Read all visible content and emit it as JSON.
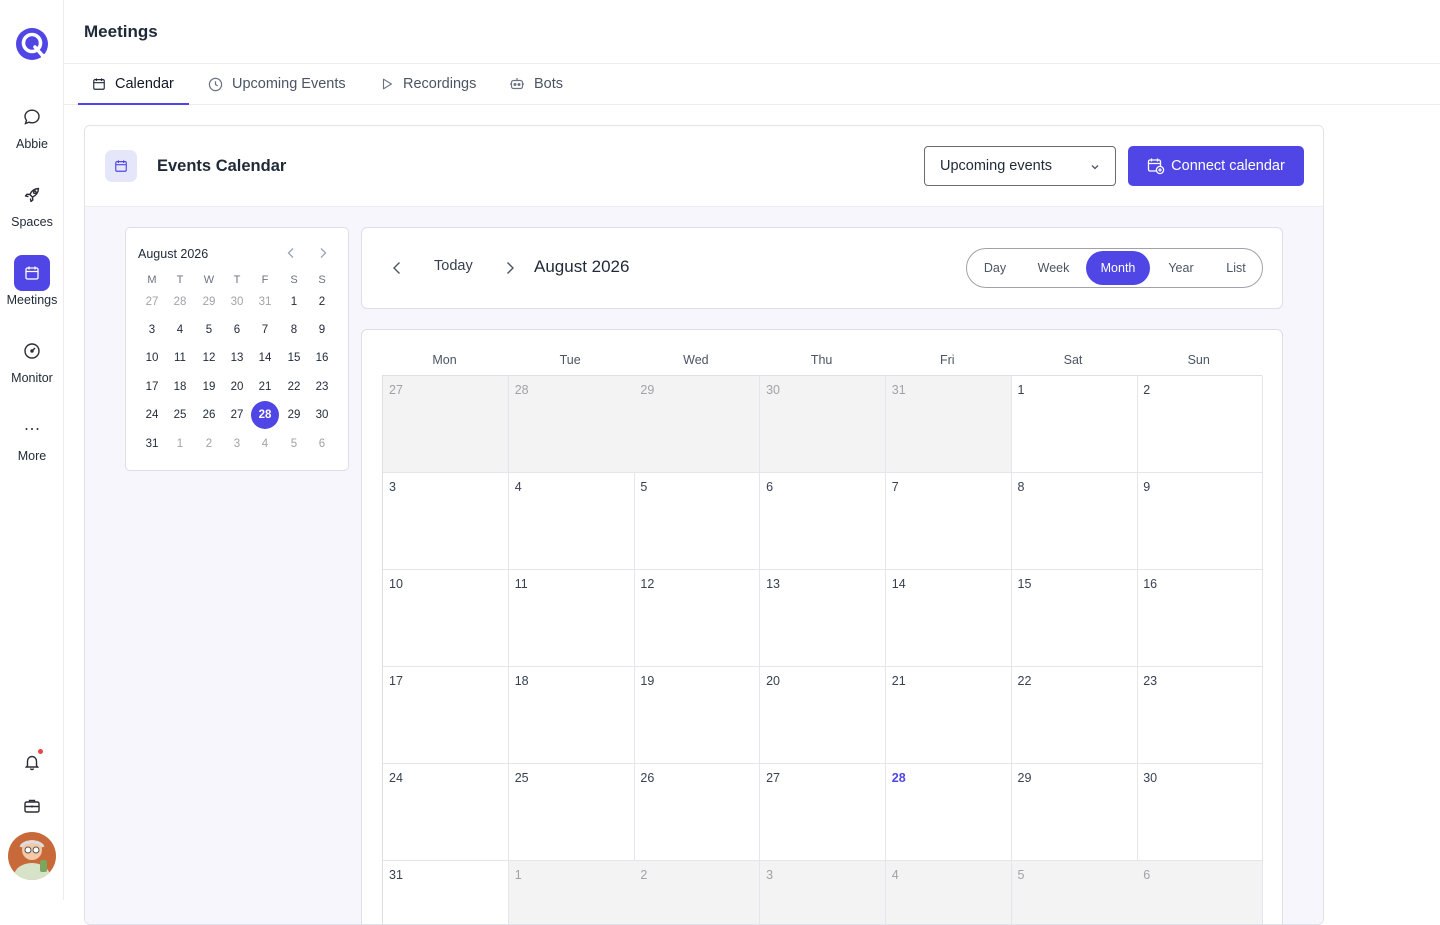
{
  "nav": {
    "items": [
      {
        "label": "Abbie",
        "icon": "chat-bubble-icon"
      },
      {
        "label": "Spaces",
        "icon": "rocket-icon"
      },
      {
        "label": "Meetings",
        "icon": "calendar-icon"
      },
      {
        "label": "Monitor",
        "icon": "gauge-icon"
      },
      {
        "label": "More",
        "icon": "ellipsis-icon"
      }
    ]
  },
  "header": {
    "title": "Meetings"
  },
  "tabs": [
    "Calendar",
    "Upcoming Events",
    "Recordings",
    "Bots"
  ],
  "card": {
    "title": "Events Calendar",
    "filter_value": "Upcoming events",
    "connect_label": "Connect calendar"
  },
  "mini_calendar": {
    "title": "August 2026",
    "dow": [
      "M",
      "T",
      "W",
      "T",
      "F",
      "S",
      "S"
    ],
    "weeks": [
      [
        "27",
        "28",
        "29",
        "30",
        "31",
        "1",
        "2"
      ],
      [
        "3",
        "4",
        "5",
        "6",
        "7",
        "8",
        "9"
      ],
      [
        "10",
        "11",
        "12",
        "13",
        "14",
        "15",
        "16"
      ],
      [
        "17",
        "18",
        "19",
        "20",
        "21",
        "22",
        "23"
      ],
      [
        "24",
        "25",
        "26",
        "27",
        "28",
        "29",
        "30"
      ],
      [
        "31",
        "1",
        "2",
        "3",
        "4",
        "5",
        "6"
      ]
    ],
    "selected": "28"
  },
  "toolbar": {
    "today_label": "Today",
    "title": "August 2026",
    "views": [
      "Day",
      "Week",
      "Month",
      "Year",
      "List"
    ],
    "active_view": "Month"
  },
  "month": {
    "dow": [
      "Mon",
      "Tue",
      "Wed",
      "Thu",
      "Fri",
      "Sat",
      "Sun"
    ],
    "weeks": [
      [
        "27",
        "28",
        "29",
        "30",
        "31",
        "1",
        "2"
      ],
      [
        "3",
        "4",
        "5",
        "6",
        "7",
        "8",
        "9"
      ],
      [
        "10",
        "11",
        "12",
        "13",
        "14",
        "15",
        "16"
      ],
      [
        "17",
        "18",
        "19",
        "20",
        "21",
        "22",
        "23"
      ],
      [
        "24",
        "25",
        "26",
        "27",
        "28",
        "29",
        "30"
      ],
      [
        "31",
        "1",
        "2",
        "3",
        "4",
        "5",
        "6"
      ]
    ],
    "today": "28"
  },
  "colors": {
    "accent": "#4f46e5",
    "notification": "#ef4444"
  }
}
